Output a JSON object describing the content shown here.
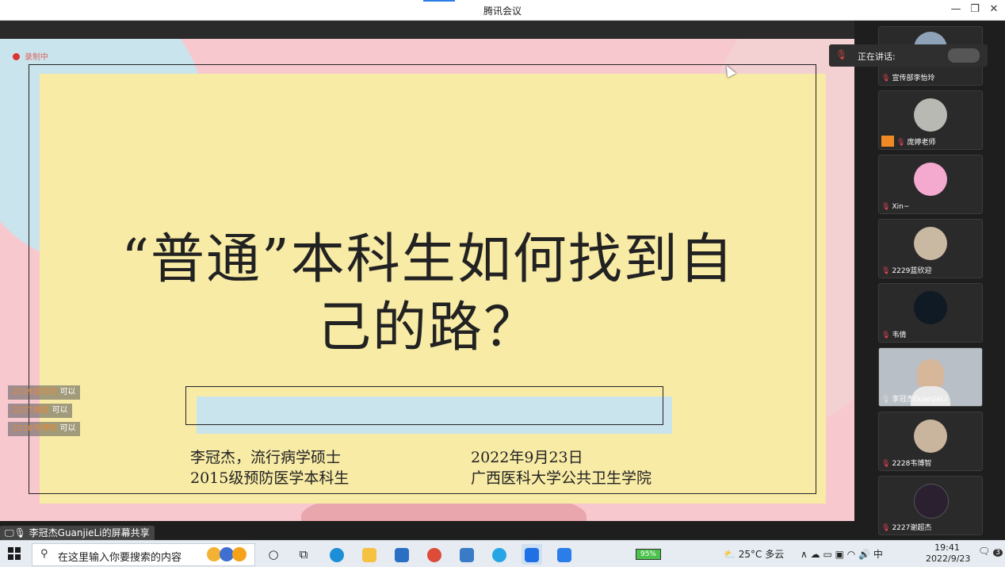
{
  "window": {
    "title": "腾讯会议",
    "controls": [
      "—",
      "❐",
      "✕"
    ]
  },
  "recording": {
    "label": "录制中"
  },
  "slide": {
    "headline_line1": "“普通”本科生如何找到自",
    "headline_line2": "己的路？",
    "presenter_line1": "李冠杰，流行病学硕士",
    "presenter_line2": "2015级预防医学本科生",
    "date_line": "2022年9月23日",
    "org_line": "广西医科大学公共卫生学院"
  },
  "chat_bubbles": [
    {
      "who": "2229蓝欣迎",
      "text": "可以"
    },
    {
      "who": "2227谢超",
      "text": "可以"
    },
    {
      "who": "2228韦博智",
      "text": "可以"
    }
  ],
  "share": {
    "label": "李冠杰GuanjieLi的屏幕共享"
  },
  "speaking": {
    "label": "正在讲话:"
  },
  "participants": [
    {
      "name": "宣传部李怡玲",
      "avatar_color": "#8fa3b8",
      "muted": true
    },
    {
      "name": "庞婷老师",
      "avatar_color": "#b9b9b4",
      "muted": true,
      "badge": true
    },
    {
      "name": "Xin~",
      "avatar_color": "#f4a9cf",
      "muted": true
    },
    {
      "name": "2229蓝欣迎",
      "avatar_color": "#c9b8a2",
      "muted": true
    },
    {
      "name": "韦倩",
      "avatar_color": "#0f1a24",
      "muted": true
    },
    {
      "name": "李冠杰GuanjieLi",
      "avatar_color": "#c8c8c8",
      "muted": false,
      "video": true
    },
    {
      "name": "2228韦博智",
      "avatar_color": "#c9b59e",
      "muted": true
    },
    {
      "name": "2227谢超杰",
      "avatar_color": "#2a2030",
      "muted": true
    }
  ],
  "taskbar": {
    "search_placeholder": "在这里输入你要搜索的内容",
    "battery": "95%",
    "weather": "25°C 多云",
    "ime": "中",
    "time": "19:41",
    "date": "2022/9/23",
    "notifications": "3"
  },
  "colors": {
    "slide_yellow": "#f8eba6",
    "slide_pink": "#f7c9cf",
    "slide_blue": "#c9e4ec",
    "mute_red": "#e44455"
  }
}
